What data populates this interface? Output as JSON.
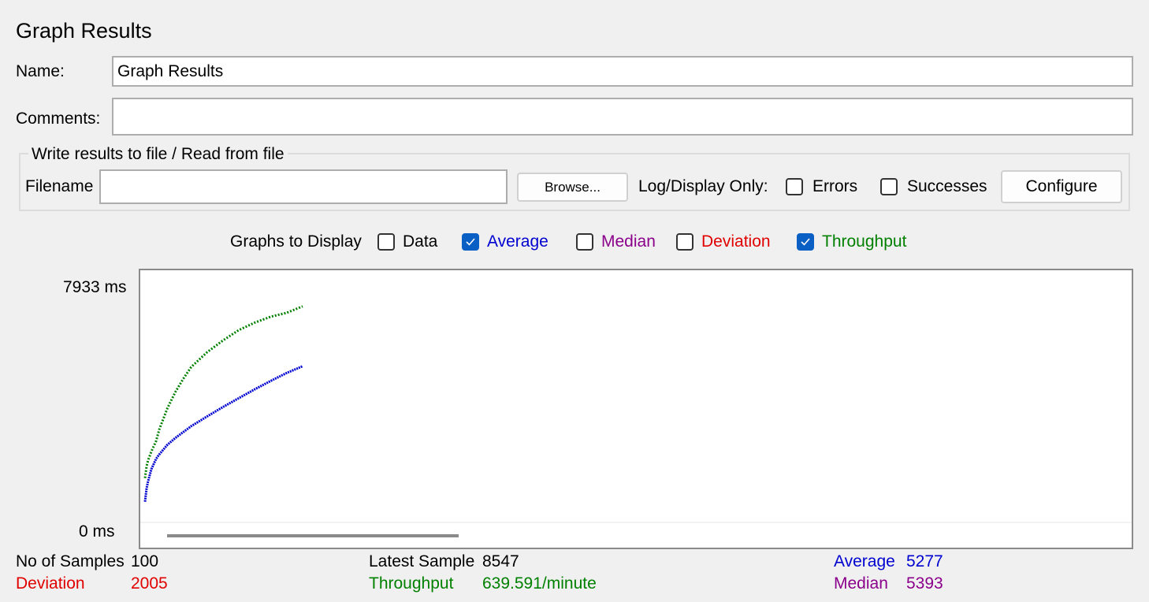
{
  "title": "Graph Results",
  "name_label": "Name:",
  "name_value": "Graph Results",
  "comments_label": "Comments:",
  "comments_value": "",
  "file_group": {
    "title": "Write results to file / Read from file",
    "filename_label": "Filename",
    "filename_value": "",
    "browse_label": "Browse...",
    "log_display_label": "Log/Display Only:",
    "errors": {
      "label": "Errors",
      "checked": false
    },
    "successes": {
      "label": "Successes",
      "checked": false
    },
    "configure_label": "Configure"
  },
  "graphs_to_display": {
    "label": "Graphs to Display",
    "options": [
      {
        "label": "Data",
        "checked": false,
        "color": "#000000"
      },
      {
        "label": "Average",
        "checked": true,
        "color": "#0000d0"
      },
      {
        "label": "Median",
        "checked": false,
        "color": "#8b008b"
      },
      {
        "label": "Deviation",
        "checked": false,
        "color": "#e00000"
      },
      {
        "label": "Throughput",
        "checked": true,
        "color": "#008000"
      }
    ]
  },
  "chart_data": {
    "type": "line",
    "y_max_label": "7933  ms",
    "y_min_label": "0  ms",
    "ylim": [
      0,
      7933
    ],
    "x_range": [
      1,
      100
    ],
    "x_capacity": 620,
    "series": [
      {
        "name": "Average",
        "color": "#0000d0",
        "style": "solid",
        "x": [
          1,
          2,
          3,
          5,
          8,
          10,
          15,
          20,
          30,
          40,
          50,
          60,
          70,
          80,
          90,
          100
        ],
        "y": [
          700,
          1150,
          1400,
          1800,
          2150,
          2300,
          2620,
          2850,
          3250,
          3580,
          3900,
          4200,
          4500,
          4780,
          5050,
          5277
        ]
      },
      {
        "name": "Throughput",
        "color": "#008000",
        "style": "dotted",
        "x": [
          1,
          2,
          3,
          5,
          8,
          10,
          15,
          20,
          25,
          30,
          40,
          50,
          60,
          70,
          80,
          90,
          100
        ],
        "y": [
          1500,
          1900,
          2100,
          2400,
          2750,
          3150,
          3850,
          4400,
          4850,
          5250,
          5750,
          6150,
          6500,
          6750,
          6950,
          7080,
          7300
        ]
      }
    ]
  },
  "stats": {
    "samples": {
      "label": "No of Samples",
      "value": "100"
    },
    "latest": {
      "label": "Latest Sample",
      "value": "8547"
    },
    "average": {
      "label": "Average",
      "value": "5277",
      "color": "#0000d0"
    },
    "deviation": {
      "label": "Deviation",
      "value": "2005",
      "color": "#e00000"
    },
    "throughput": {
      "label": "Throughput",
      "value": "639.591/minute",
      "color": "#008000"
    },
    "median": {
      "label": "Median",
      "value": "5393",
      "color": "#8b008b"
    }
  }
}
